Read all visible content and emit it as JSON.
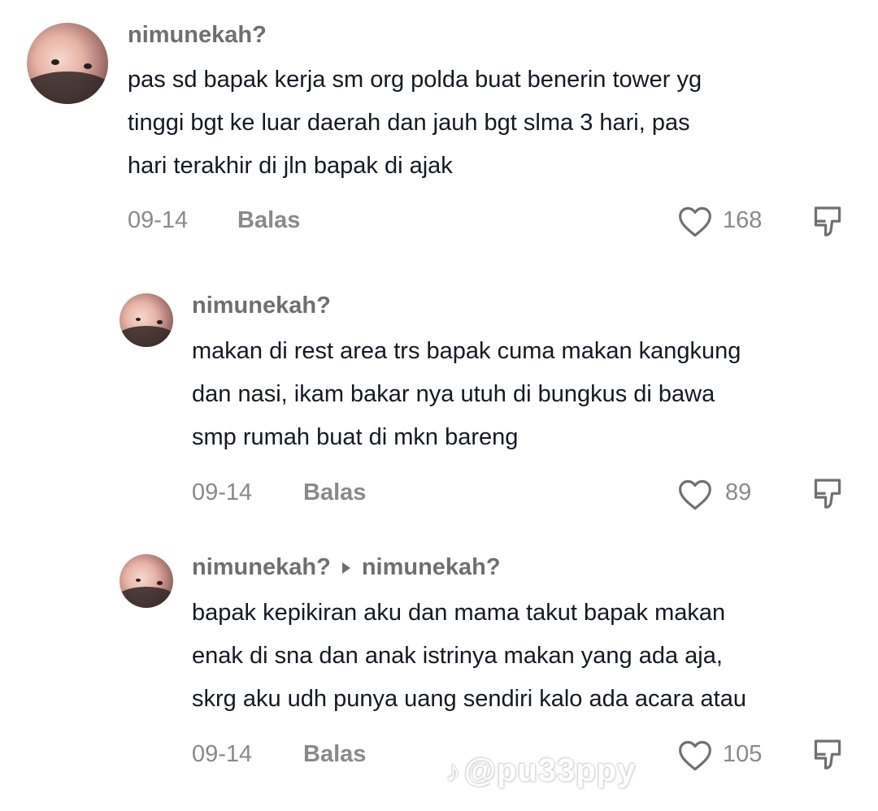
{
  "comments": [
    {
      "username": "nimunekah?",
      "text": "pas sd bapak kerja sm org polda buat benerin tower yg\ntinggi bgt ke luar daerah dan jauh bgt slma 3 hari, pas\nhari terakhir di jln bapak di ajak",
      "date": "09-14",
      "reply_label": "Balas",
      "likes": "168"
    },
    {
      "username": "nimunekah?",
      "text": "makan di rest area trs bapak cuma makan kangkung\ndan nasi, ikam bakar nya utuh di bungkus di bawa\nsmp rumah buat di mkn bareng",
      "date": "09-14",
      "reply_label": "Balas",
      "likes": "89"
    },
    {
      "username": "nimunekah?",
      "reply_to": "nimunekah?",
      "text": "bapak kepikiran aku dan mama takut bapak makan\nenak di sna dan anak istrinya makan yang ada aja,\nskrg aku udh punya uang sendiri kalo ada acara atau",
      "date": "09-14",
      "reply_label": "Balas",
      "likes": "105"
    }
  ],
  "watermark": {
    "logo": "tiktok-note-icon",
    "handle": "@pu33ppy"
  },
  "colors": {
    "username": "#6f6f6f",
    "text": "#161823",
    "meta": "#8a8a8a"
  }
}
